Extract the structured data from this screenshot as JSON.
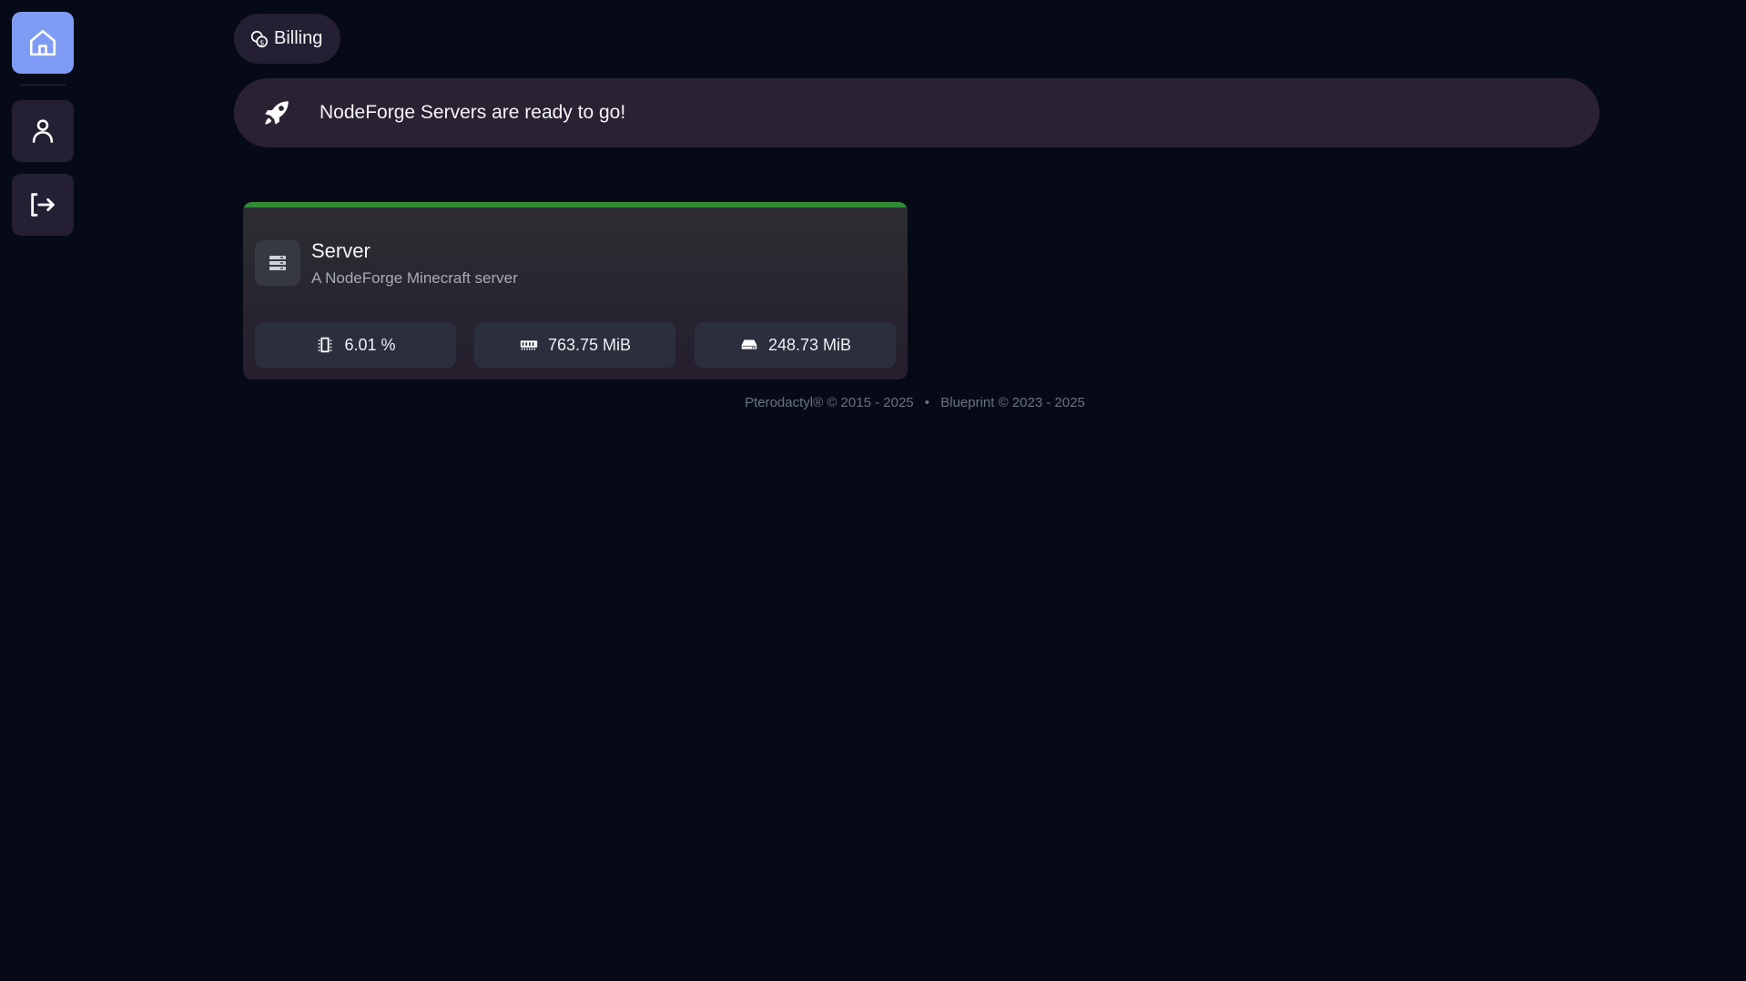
{
  "sidebar": {
    "items": [
      {
        "name": "home",
        "icon": "home-icon",
        "active": true
      },
      {
        "name": "account",
        "icon": "user-icon",
        "active": false
      },
      {
        "name": "logout",
        "icon": "logout-icon",
        "active": false
      }
    ]
  },
  "billing": {
    "label": "Billing",
    "icon": "coins-icon"
  },
  "banner": {
    "text": "NodeForge Servers are ready to go!",
    "icon": "rocket-icon"
  },
  "server_card": {
    "name": "Server",
    "description": "A NodeForge Minecraft server",
    "status_color": "#2f8a34",
    "stats": {
      "cpu": "6.01 %",
      "memory": "763.75 MiB",
      "disk": "248.73 MiB"
    }
  },
  "footer": {
    "pterodactyl": "Pterodactyl® © 2015 - 2025",
    "separator": "•",
    "blueprint": "Blueprint © 2023 - 2025"
  },
  "colors": {
    "background": "#060a17",
    "accent": "#7f9cf5",
    "panel": "#241f33",
    "status_running": "#2f8a34"
  }
}
